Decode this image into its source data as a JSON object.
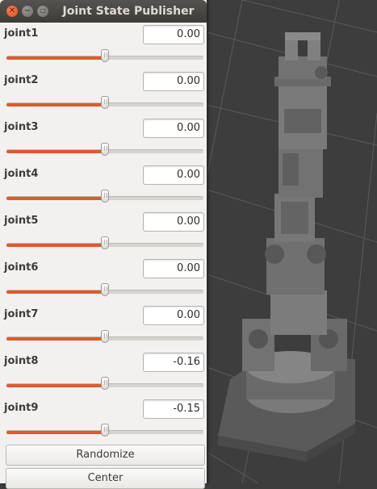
{
  "window": {
    "title": "Joint State Publisher",
    "close_glyph": "✕",
    "min_glyph": "−",
    "max_glyph": "▫"
  },
  "joints": [
    {
      "label": "joint1",
      "value": "0.00",
      "slider": 0.5
    },
    {
      "label": "joint2",
      "value": "0.00",
      "slider": 0.5
    },
    {
      "label": "joint3",
      "value": "0.00",
      "slider": 0.5
    },
    {
      "label": "joint4",
      "value": "0.00",
      "slider": 0.5
    },
    {
      "label": "joint5",
      "value": "0.00",
      "slider": 0.5
    },
    {
      "label": "joint6",
      "value": "0.00",
      "slider": 0.5
    },
    {
      "label": "joint7",
      "value": "0.00",
      "slider": 0.5
    },
    {
      "label": "joint8",
      "value": "-0.16",
      "slider": 0.5
    },
    {
      "label": "joint9",
      "value": "-0.15",
      "slider": 0.5
    }
  ],
  "buttons": {
    "randomize": "Randomize",
    "center": "Center"
  },
  "colors": {
    "slider_fill": "#e05a2b",
    "viewport_bg": "#3c3c3c",
    "robot": "#6e6e6e"
  }
}
